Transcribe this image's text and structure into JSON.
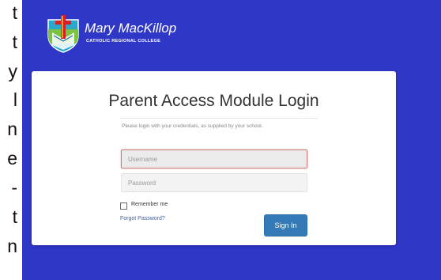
{
  "side_text": [
    "t",
    "t",
    "y",
    "l",
    "n",
    "e",
    "-",
    "t",
    "n"
  ],
  "brand": {
    "name": "Mary MacKillop",
    "subtitle": "CATHOLIC REGIONAL COLLEGE",
    "icon": "college-crest-icon"
  },
  "colors": {
    "background": "#2f37c6",
    "button": "#337ab7",
    "link": "#3b63b3"
  },
  "login": {
    "title": "Parent Access Module Login",
    "instructions": "Please login with your credentials, as supplied by your school.",
    "username_placeholder": "Username",
    "username_value": "",
    "password_placeholder": "Password",
    "password_value": "",
    "remember_label": "Remember me",
    "remember_checked": false,
    "forgot_label": "Forgot Password?",
    "signin_label": "Sign In"
  }
}
